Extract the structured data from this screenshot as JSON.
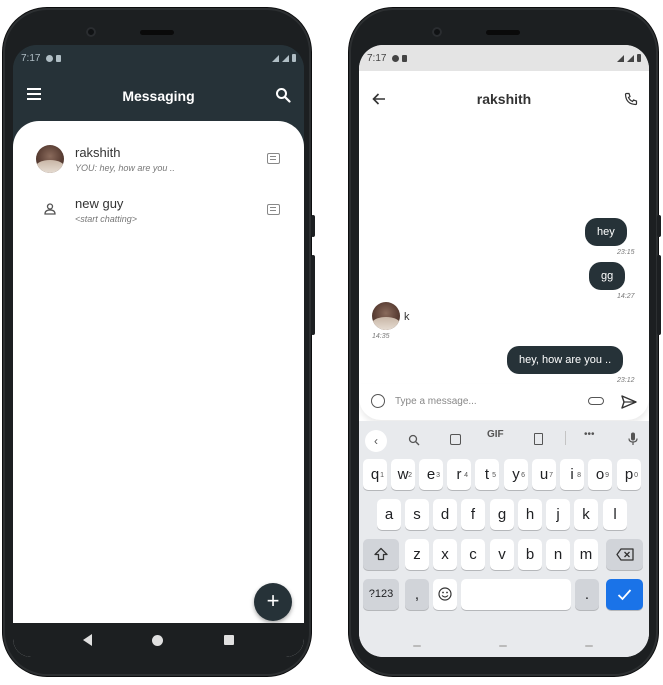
{
  "status": {
    "time": "7:17"
  },
  "left_app": {
    "title": "Messaging",
    "chats": [
      {
        "name": "rakshith",
        "subtitle": "YOU: hey, how are you .."
      },
      {
        "name": "new guy",
        "subtitle": "<start chatting>"
      }
    ],
    "fab_label": "+"
  },
  "right_app": {
    "contact_name": "rakshith",
    "messages": [
      {
        "text": "hey",
        "time": "23:15",
        "sender": "me"
      },
      {
        "text": "gg",
        "time": "14:27",
        "sender": "me"
      },
      {
        "text": "k",
        "time": "14:35",
        "sender": "them"
      },
      {
        "text": "hey, how are you ..",
        "time": "23:12",
        "sender": "me"
      }
    ],
    "input_placeholder": "Type a message..."
  },
  "keyboard": {
    "toolbar": [
      "GIF",
      "•••"
    ],
    "row1": [
      {
        "k": "q",
        "h": "1"
      },
      {
        "k": "w",
        "h": "2"
      },
      {
        "k": "e",
        "h": "3"
      },
      {
        "k": "r",
        "h": "4"
      },
      {
        "k": "t",
        "h": "5"
      },
      {
        "k": "y",
        "h": "6"
      },
      {
        "k": "u",
        "h": "7"
      },
      {
        "k": "i",
        "h": "8"
      },
      {
        "k": "o",
        "h": "9"
      },
      {
        "k": "p",
        "h": "0"
      }
    ],
    "row2": [
      "a",
      "s",
      "d",
      "f",
      "g",
      "h",
      "j",
      "k",
      "l"
    ],
    "row3": [
      "z",
      "x",
      "c",
      "v",
      "b",
      "n",
      "m"
    ],
    "sym_label": "?123",
    "comma": ",",
    "period": "."
  },
  "colors": {
    "primary": "#263238",
    "enter": "#1a73e8",
    "keyboard_bg": "#e8eaed"
  },
  "icons": [
    "menu-icon",
    "search-icon",
    "message-icon",
    "person-icon",
    "back-arrow-icon",
    "phone-icon",
    "emoji-icon",
    "attach-icon",
    "send-icon",
    "shift-icon",
    "backspace-icon",
    "mic-icon",
    "check-icon"
  ]
}
